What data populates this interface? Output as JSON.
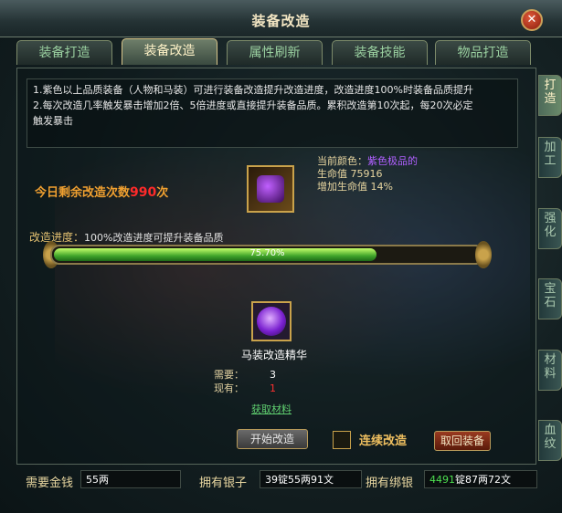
{
  "window": {
    "title": "装备改造",
    "close": "✕"
  },
  "tabs": [
    {
      "label": "装备打造"
    },
    {
      "label": "装备改造"
    },
    {
      "label": "属性刷新"
    },
    {
      "label": "装备技能"
    },
    {
      "label": "物品打造"
    }
  ],
  "side_tabs": [
    {
      "label": "打造"
    },
    {
      "label": "加工"
    },
    {
      "label": "强化"
    },
    {
      "label": "宝石"
    },
    {
      "label": "材料"
    },
    {
      "label": "血纹"
    }
  ],
  "info": {
    "line1": "1.紫色以上品质装备（人物和马装）可进行装备改造提升改造进度，改造进度100%时装备品质提升",
    "line2": "2.每次改造几率触发暴击增加2倍、5倍进度或直接提升装备品质。累积改造第10次起，每20次必定",
    "line3": "触发暴击"
  },
  "remaining": {
    "label": "今日剩余改造次数",
    "count": "990",
    "suffix": "次"
  },
  "item": {
    "color_label": "当前颜色：",
    "color_value": "紫色极品的",
    "hp_label": "生命值 75916",
    "hp_bonus": "增加生命值 14%"
  },
  "progress": {
    "label": "改造进度：",
    "note": "100%改造进度可提升装备品质",
    "percent": 75.7,
    "text": "75.70%"
  },
  "material": {
    "name": "马装改造精华",
    "need_label": "需要：",
    "need_value": "3",
    "have_label": "现有：",
    "have_value": "1",
    "get_link": "获取材料"
  },
  "buttons": {
    "start": "开始改造",
    "continuous": "连续改造",
    "retrieve": "取回装备"
  },
  "footer": {
    "cost_label": "需要金钱",
    "cost_value": "55两",
    "silver_label": "拥有银子",
    "silver_value": "39锭55两91文",
    "bound_label": "拥有绑银",
    "bound_green": "4491",
    "bound_rest": "锭87两72文"
  },
  "colors": {
    "accent_gold": "#c9a24b",
    "progress_green": "#3fa32a",
    "warning_red": "#ff2a2a"
  }
}
